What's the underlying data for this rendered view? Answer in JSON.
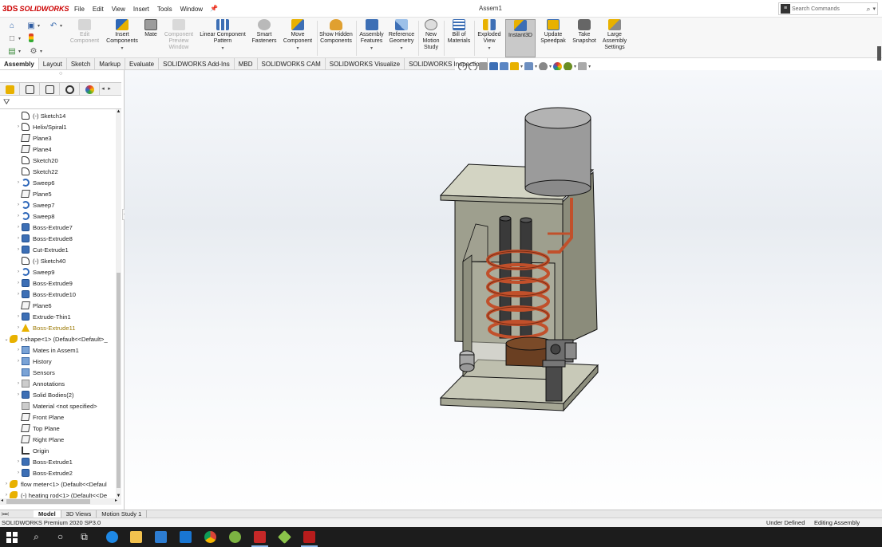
{
  "app": {
    "logo_mark": "3DS",
    "logo_text": "SOLIDWORKS",
    "window_title": "Assem1",
    "menus": [
      "File",
      "Edit",
      "View",
      "Insert",
      "Tools",
      "Window"
    ],
    "search_placeholder": "Search Commands"
  },
  "toolbar": {
    "tools": [
      {
        "label": "Edit Component",
        "icon": "edit-component-icon",
        "enabled": false
      },
      {
        "label": "Insert Components",
        "icon": "insert-components-icon",
        "enabled": true
      },
      {
        "label": "Mate",
        "icon": "mate-icon",
        "enabled": true
      },
      {
        "label": "Component Preview Window",
        "icon": "component-preview-icon",
        "enabled": false
      },
      {
        "label": "Linear Component Pattern",
        "icon": "linear-pattern-icon",
        "enabled": true
      },
      {
        "label": "Smart Fasteners",
        "icon": "smart-fasteners-icon",
        "enabled": true
      },
      {
        "label": "Move Component",
        "icon": "move-component-icon",
        "enabled": true
      },
      {
        "label": "Show Hidden Components",
        "icon": "show-hidden-icon",
        "enabled": true
      },
      {
        "label": "Assembly Features",
        "icon": "assembly-features-icon",
        "enabled": true
      },
      {
        "label": "Reference Geometry",
        "icon": "reference-geometry-icon",
        "enabled": true
      },
      {
        "label": "New Motion Study",
        "icon": "motion-study-icon",
        "enabled": true
      },
      {
        "label": "Bill of Materials",
        "icon": "bom-icon",
        "enabled": true
      },
      {
        "label": "Exploded View",
        "icon": "exploded-view-icon",
        "enabled": true
      },
      {
        "label": "Instant3D",
        "icon": "instant3d-icon",
        "enabled": true,
        "active": true
      },
      {
        "label": "Update Speedpak",
        "icon": "speedpak-icon",
        "enabled": true
      },
      {
        "label": "Take Snapshot",
        "icon": "snapshot-icon",
        "enabled": true
      },
      {
        "label": "Large Assembly Settings",
        "icon": "large-assembly-icon",
        "enabled": true
      }
    ]
  },
  "tabs": [
    "Assembly",
    "Layout",
    "Sketch",
    "Markup",
    "Evaluate",
    "SOLIDWORKS Add-Ins",
    "MBD",
    "SOLIDWORKS CAM",
    "SOLIDWORKS Visualize",
    "SOLIDWORKS Inspection"
  ],
  "active_tab": "Assembly",
  "tree": [
    {
      "label": "(-) Sketch14",
      "icon": "sketch",
      "level": 1,
      "expand": false
    },
    {
      "label": "Helix/Spiral1",
      "icon": "sketch",
      "level": 1,
      "expand": true
    },
    {
      "label": "Plane3",
      "icon": "plane",
      "level": 1,
      "expand": false
    },
    {
      "label": "Plane4",
      "icon": "plane",
      "level": 1,
      "expand": false
    },
    {
      "label": "Sketch20",
      "icon": "sketch",
      "level": 1,
      "expand": false
    },
    {
      "label": "Sketch22",
      "icon": "sketch",
      "level": 1,
      "expand": false
    },
    {
      "label": "Sweep6",
      "icon": "sweep",
      "level": 1,
      "expand": true
    },
    {
      "label": "Plane5",
      "icon": "plane",
      "level": 1,
      "expand": false
    },
    {
      "label": "Sweep7",
      "icon": "sweep",
      "level": 1,
      "expand": true
    },
    {
      "label": "Sweep8",
      "icon": "sweep",
      "level": 1,
      "expand": true
    },
    {
      "label": "Boss-Extrude7",
      "icon": "feat",
      "level": 1,
      "expand": true
    },
    {
      "label": "Boss-Extrude8",
      "icon": "feat",
      "level": 1,
      "expand": true
    },
    {
      "label": "Cut-Extrude1",
      "icon": "feat",
      "level": 1,
      "expand": true
    },
    {
      "label": "(-) Sketch40",
      "icon": "sketch",
      "level": 1,
      "expand": false
    },
    {
      "label": "Sweep9",
      "icon": "sweep",
      "level": 1,
      "expand": true
    },
    {
      "label": "Boss-Extrude9",
      "icon": "feat",
      "level": 1,
      "expand": true
    },
    {
      "label": "Boss-Extrude10",
      "icon": "feat",
      "level": 1,
      "expand": true
    },
    {
      "label": "Plane6",
      "icon": "plane",
      "level": 1,
      "expand": false
    },
    {
      "label": "Extrude-Thin1",
      "icon": "feat",
      "level": 1,
      "expand": true
    },
    {
      "label": "Boss-Extrude11",
      "icon": "warn",
      "level": 1,
      "expand": true,
      "warning": true
    },
    {
      "label": "t-shape<1> (Default<<Default>_",
      "icon": "part",
      "level": 0,
      "expand": true,
      "open": true
    },
    {
      "label": "Mates in Assem1",
      "icon": "folder",
      "level": 1,
      "expand": true
    },
    {
      "label": "History",
      "icon": "folder",
      "level": 1,
      "expand": true
    },
    {
      "label": "Sensors",
      "icon": "folder",
      "level": 1,
      "expand": false
    },
    {
      "label": "Annotations",
      "icon": "ann",
      "level": 1,
      "expand": true
    },
    {
      "label": "Solid Bodies(2)",
      "icon": "feat",
      "level": 1,
      "expand": true
    },
    {
      "label": "Material <not specified>",
      "icon": "ann",
      "level": 1,
      "expand": false
    },
    {
      "label": "Front Plane",
      "icon": "plane",
      "level": 1,
      "expand": false
    },
    {
      "label": "Top Plane",
      "icon": "plane",
      "level": 1,
      "expand": false
    },
    {
      "label": "Right Plane",
      "icon": "plane",
      "level": 1,
      "expand": false
    },
    {
      "label": "Origin",
      "icon": "origin",
      "level": 1,
      "expand": false
    },
    {
      "label": "Boss-Extrude1",
      "icon": "feat",
      "level": 1,
      "expand": true
    },
    {
      "label": "Boss-Extrude2",
      "icon": "feat",
      "level": 1,
      "expand": true
    },
    {
      "label": "flow meter<1> (Default<<Defaul",
      "icon": "part",
      "level": 0,
      "expand": true
    },
    {
      "label": "(-) heating rod<1> (Default<<De",
      "icon": "part",
      "level": 0,
      "expand": true
    }
  ],
  "bottom_tabs": [
    "Model",
    "3D Views",
    "Motion Study 1"
  ],
  "active_bottom_tab": "Model",
  "status": {
    "version": "SOLIDWORKS Premium 2020 SP3.0",
    "definition": "Under Defined",
    "mode": "Editing Assembly"
  },
  "taskbar_items": [
    "start-icon",
    "search-icon",
    "cortana-icon",
    "task-view-icon",
    "edge-icon",
    "file-explorer-icon",
    "store-icon",
    "mail-icon",
    "chrome-icon",
    "network-app-icon",
    "solidworks-icon",
    "green-app-icon",
    "solidworks-2020-icon"
  ],
  "colors": {
    "brand_red": "#cc0000",
    "accent_blue": "#3d6fb5",
    "copper": "#c1502b"
  }
}
